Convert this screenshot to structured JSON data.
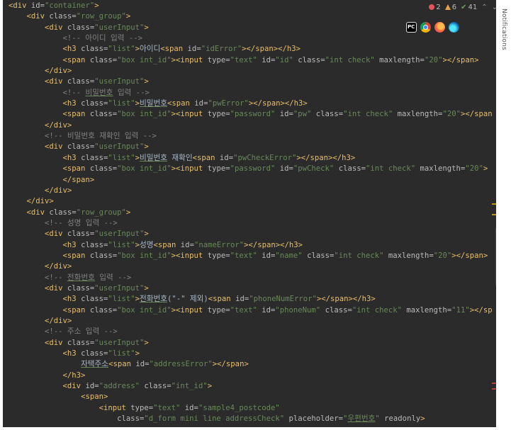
{
  "inspections": {
    "errors": "2",
    "warnings": "6",
    "weak_warnings": "41",
    "up_arrow": "⌃",
    "down_arrow": "⌄"
  },
  "side_panel": {
    "notifications_label": "Notifications"
  },
  "browser_icons": [
    "pycharm-icon",
    "chrome-icon",
    "firefox-icon",
    "edge-icon"
  ],
  "browser_labels": {
    "pycharm": "PC"
  },
  "colors": {
    "editor_bg": "#2b2b2b",
    "tag": "#e8bf6a",
    "attr": "#bababa",
    "value": "#6a8759",
    "comment": "#808080",
    "text": "#a9b7c6"
  },
  "code": {
    "lines": [
      [
        [
          "tag",
          "<div "
        ],
        [
          "attr",
          "id"
        ],
        [
          "eq",
          "="
        ],
        [
          "val",
          "\"container\""
        ],
        [
          "tag",
          ">"
        ]
      ],
      [
        [
          "ws",
          "    "
        ],
        [
          "tag",
          "<div "
        ],
        [
          "attr",
          "class"
        ],
        [
          "eq",
          "="
        ],
        [
          "val",
          "\"row_group\""
        ],
        [
          "tag",
          ">"
        ]
      ],
      [
        [
          "ws",
          "        "
        ],
        [
          "tag",
          "<div "
        ],
        [
          "attr",
          "class"
        ],
        [
          "eq",
          "="
        ],
        [
          "val",
          "\"userInput\""
        ],
        [
          "tag",
          ">"
        ]
      ],
      [
        [
          "ws",
          "            "
        ],
        [
          "cm",
          "<!-- 아이디 입력 -->"
        ]
      ],
      [
        [
          "ws",
          "            "
        ],
        [
          "tag",
          "<h3 "
        ],
        [
          "attr",
          "class"
        ],
        [
          "eq",
          "="
        ],
        [
          "val",
          "\"list\""
        ],
        [
          "tag",
          ">"
        ],
        [
          "txt",
          "아이디"
        ],
        [
          "tag",
          "<span "
        ],
        [
          "attr",
          "id"
        ],
        [
          "eq",
          "="
        ],
        [
          "val",
          "\"idError\""
        ],
        [
          "tag",
          "></span></h3>"
        ]
      ],
      [
        [
          "ws",
          "            "
        ],
        [
          "tag",
          "<span "
        ],
        [
          "attr",
          "class"
        ],
        [
          "eq",
          "="
        ],
        [
          "val",
          "\"box int_id\""
        ],
        [
          "tag",
          "><input "
        ],
        [
          "attr",
          "type"
        ],
        [
          "eq",
          "="
        ],
        [
          "val",
          "\"text\""
        ],
        [
          "attr",
          " id"
        ],
        [
          "eq",
          "="
        ],
        [
          "val",
          "\"id\""
        ],
        [
          "attr",
          " class"
        ],
        [
          "eq",
          "="
        ],
        [
          "val",
          "\"int check\""
        ],
        [
          "attr",
          " maxlength"
        ],
        [
          "eq",
          "="
        ],
        [
          "val",
          "\"20\""
        ],
        [
          "tag",
          "></span>"
        ]
      ],
      [
        [
          "ws",
          "        "
        ],
        [
          "tag",
          "</div>"
        ]
      ],
      [
        [
          "ws",
          "        "
        ],
        [
          "tag",
          "<div "
        ],
        [
          "attr",
          "class"
        ],
        [
          "eq",
          "="
        ],
        [
          "val",
          "\"userInput\""
        ],
        [
          "tag",
          ">"
        ]
      ],
      [
        [
          "ws",
          "            "
        ],
        [
          "cm",
          "<!-- "
        ],
        [
          "cmu",
          "비밀번호"
        ],
        [
          "cm",
          " 입력 -->"
        ]
      ],
      [
        [
          "ws",
          "            "
        ],
        [
          "tag",
          "<h3 "
        ],
        [
          "attr",
          "class"
        ],
        [
          "eq",
          "="
        ],
        [
          "val",
          "\"list\""
        ],
        [
          "tag",
          ">"
        ],
        [
          "txtu",
          "비밀번호"
        ],
        [
          "tag",
          "<span "
        ],
        [
          "attr",
          "id"
        ],
        [
          "eq",
          "="
        ],
        [
          "val",
          "\"pwError\""
        ],
        [
          "tag",
          "></span></h3>"
        ]
      ],
      [
        [
          "ws",
          "            "
        ],
        [
          "tag",
          "<span "
        ],
        [
          "attr",
          "class"
        ],
        [
          "eq",
          "="
        ],
        [
          "val",
          "\"box int_id\""
        ],
        [
          "tag",
          "><input "
        ],
        [
          "attr",
          "type"
        ],
        [
          "eq",
          "="
        ],
        [
          "val",
          "\"password\""
        ],
        [
          "attr",
          " id"
        ],
        [
          "eq",
          "="
        ],
        [
          "val",
          "\"pw\""
        ],
        [
          "attr",
          " class"
        ],
        [
          "eq",
          "="
        ],
        [
          "val",
          "\"int check\""
        ],
        [
          "attr",
          " maxlength"
        ],
        [
          "eq",
          "="
        ],
        [
          "val",
          "\"20\""
        ],
        [
          "tag",
          "></span"
        ]
      ],
      [
        [
          "ws",
          "        "
        ],
        [
          "tag",
          "</div>"
        ]
      ],
      [
        [
          "ws",
          "        "
        ],
        [
          "cm",
          "<!-- 비밀번호 재확인 입력 -->"
        ]
      ],
      [
        [
          "ws",
          "        "
        ],
        [
          "tag",
          "<div "
        ],
        [
          "attr",
          "class"
        ],
        [
          "eq",
          "="
        ],
        [
          "val",
          "\"userInput\""
        ],
        [
          "tag",
          ">"
        ]
      ],
      [
        [
          "ws",
          "            "
        ],
        [
          "tag",
          "<h3 "
        ],
        [
          "attr",
          "class"
        ],
        [
          "eq",
          "="
        ],
        [
          "val",
          "\"list\""
        ],
        [
          "tag",
          ">"
        ],
        [
          "txtu",
          "비밀번호"
        ],
        [
          "txt",
          " 재확인"
        ],
        [
          "tag",
          "<span "
        ],
        [
          "attr",
          "id"
        ],
        [
          "eq",
          "="
        ],
        [
          "val",
          "\"pwCheckError\""
        ],
        [
          "tag",
          "></span></h3>"
        ]
      ],
      [
        [
          "ws",
          "            "
        ],
        [
          "tag",
          "<span "
        ],
        [
          "attr",
          "class"
        ],
        [
          "eq",
          "="
        ],
        [
          "val",
          "\"box int_id\""
        ],
        [
          "tag",
          "><input "
        ],
        [
          "attr",
          "type"
        ],
        [
          "eq",
          "="
        ],
        [
          "val",
          "\"password\""
        ],
        [
          "attr",
          " id"
        ],
        [
          "eq",
          "="
        ],
        [
          "val",
          "\"pwCheck\""
        ],
        [
          "attr",
          " class"
        ],
        [
          "eq",
          "="
        ],
        [
          "val",
          "\"int check\""
        ],
        [
          "attr",
          " maxlength"
        ],
        [
          "eq",
          "="
        ],
        [
          "val",
          "\"20\""
        ],
        [
          "tag",
          "> "
        ]
      ],
      [
        [
          "ws",
          "            "
        ],
        [
          "tag",
          "</span>"
        ]
      ],
      [
        [
          "ws",
          "        "
        ],
        [
          "tag",
          "</div>"
        ]
      ],
      [
        [
          "ws",
          "    "
        ],
        [
          "tag",
          "</div>"
        ]
      ],
      [
        [
          "ws",
          "    "
        ],
        [
          "tag",
          "<div "
        ],
        [
          "attr",
          "class"
        ],
        [
          "eq",
          "="
        ],
        [
          "val",
          "\"row_group\""
        ],
        [
          "tag",
          ">"
        ]
      ],
      [
        [
          "ws",
          "        "
        ],
        [
          "cm",
          "<!-- 성명 입력 -->"
        ]
      ],
      [
        [
          "ws",
          "        "
        ],
        [
          "tag",
          "<div "
        ],
        [
          "attr",
          "class"
        ],
        [
          "eq",
          "="
        ],
        [
          "val",
          "\"userInput\""
        ],
        [
          "tag",
          ">"
        ]
      ],
      [
        [
          "ws",
          "            "
        ],
        [
          "tag",
          "<h3 "
        ],
        [
          "attr",
          "class"
        ],
        [
          "eq",
          "="
        ],
        [
          "val",
          "\"list\""
        ],
        [
          "tag",
          ">"
        ],
        [
          "txt",
          "성명"
        ],
        [
          "tag",
          "<span "
        ],
        [
          "attr",
          "id"
        ],
        [
          "eq",
          "="
        ],
        [
          "val",
          "\"nameError\""
        ],
        [
          "tag",
          "></span></h3>"
        ]
      ],
      [
        [
          "ws",
          "            "
        ],
        [
          "tag",
          "<span "
        ],
        [
          "attr",
          "class"
        ],
        [
          "eq",
          "="
        ],
        [
          "val",
          "\"box int_id\""
        ],
        [
          "tag",
          "><input "
        ],
        [
          "attr",
          "type"
        ],
        [
          "eq",
          "="
        ],
        [
          "val",
          "\"text\""
        ],
        [
          "attr",
          " id"
        ],
        [
          "eq",
          "="
        ],
        [
          "val",
          "\"name\""
        ],
        [
          "attr",
          " class"
        ],
        [
          "eq",
          "="
        ],
        [
          "val",
          "\"int check\""
        ],
        [
          "attr",
          " maxlength"
        ],
        [
          "eq",
          "="
        ],
        [
          "val",
          "\"20\""
        ],
        [
          "tag",
          "></span>"
        ]
      ],
      [
        [
          "ws",
          "        "
        ],
        [
          "tag",
          "</div>"
        ]
      ],
      [
        [
          "ws",
          "        "
        ],
        [
          "cm",
          "<!-- "
        ],
        [
          "cmu",
          "전화번호"
        ],
        [
          "cm",
          " 입력 -->"
        ]
      ],
      [
        [
          "ws",
          "        "
        ],
        [
          "tag",
          "<div "
        ],
        [
          "attr",
          "class"
        ],
        [
          "eq",
          "="
        ],
        [
          "val",
          "\"userInput\""
        ],
        [
          "tag",
          ">"
        ]
      ],
      [
        [
          "ws",
          "            "
        ],
        [
          "tag",
          "<h3 "
        ],
        [
          "attr",
          "class"
        ],
        [
          "eq",
          "="
        ],
        [
          "val",
          "\"list\""
        ],
        [
          "tag",
          ">"
        ],
        [
          "txtu",
          "전화번호"
        ],
        [
          "txt",
          "(\"-\" 제외)"
        ],
        [
          "tag",
          "<span "
        ],
        [
          "attr",
          "id"
        ],
        [
          "eq",
          "="
        ],
        [
          "val",
          "\"phoneNumError\""
        ],
        [
          "tag",
          "></span></h3>"
        ]
      ],
      [
        [
          "ws",
          "            "
        ],
        [
          "tag",
          "<span "
        ],
        [
          "attr",
          "class"
        ],
        [
          "eq",
          "="
        ],
        [
          "val",
          "\"box int_id\""
        ],
        [
          "tag",
          "><input "
        ],
        [
          "attr",
          "type"
        ],
        [
          "eq",
          "="
        ],
        [
          "val",
          "\"text\""
        ],
        [
          "attr",
          " id"
        ],
        [
          "eq",
          "="
        ],
        [
          "val",
          "\"phoneNum\""
        ],
        [
          "attr",
          " class"
        ],
        [
          "eq",
          "="
        ],
        [
          "val",
          "\"int check\""
        ],
        [
          "attr",
          " maxlength"
        ],
        [
          "eq",
          "="
        ],
        [
          "val",
          "\"11\""
        ],
        [
          "tag",
          "></sp"
        ]
      ],
      [
        [
          "ws",
          "        "
        ],
        [
          "tag",
          "</div>"
        ]
      ],
      [
        [
          "ws",
          "        "
        ],
        [
          "cm",
          "<!-- 주소 입력 -->"
        ]
      ],
      [
        [
          "ws",
          "        "
        ],
        [
          "tag",
          "<div "
        ],
        [
          "attr",
          "class"
        ],
        [
          "eq",
          "="
        ],
        [
          "val",
          "\"userInput\""
        ],
        [
          "tag",
          ">"
        ]
      ],
      [
        [
          "ws",
          "            "
        ],
        [
          "tag",
          "<h3 "
        ],
        [
          "attr",
          "class"
        ],
        [
          "eq",
          "="
        ],
        [
          "val",
          "\"list\""
        ],
        [
          "tag",
          ">"
        ]
      ],
      [
        [
          "ws",
          "                "
        ],
        [
          "txtu",
          "자택주소"
        ],
        [
          "tag",
          "<span "
        ],
        [
          "attr",
          "id"
        ],
        [
          "eq",
          "="
        ],
        [
          "val",
          "\"addressError\""
        ],
        [
          "tag",
          "></span>"
        ]
      ],
      [
        [
          "ws",
          "            "
        ],
        [
          "tag",
          "</h3>"
        ]
      ],
      [
        [
          "ws",
          "            "
        ],
        [
          "tag",
          "<div "
        ],
        [
          "attr",
          "id"
        ],
        [
          "eq",
          "="
        ],
        [
          "val",
          "\"address\""
        ],
        [
          "attr",
          " class"
        ],
        [
          "eq",
          "="
        ],
        [
          "val",
          "\"int_id\""
        ],
        [
          "tag",
          ">"
        ]
      ],
      [
        [
          "ws",
          "                "
        ],
        [
          "tag",
          "<span>"
        ]
      ],
      [
        [
          "ws",
          "                    "
        ],
        [
          "tag",
          "<input "
        ],
        [
          "attr",
          "type"
        ],
        [
          "eq",
          "="
        ],
        [
          "val",
          "\"text\""
        ],
        [
          "attr",
          " id"
        ],
        [
          "eq",
          "="
        ],
        [
          "val",
          "\"sample4_postcode\""
        ]
      ],
      [
        [
          "ws",
          "                        "
        ],
        [
          "attr",
          "class"
        ],
        [
          "eq",
          "="
        ],
        [
          "val",
          "\"d_form mini line addressCheck\""
        ],
        [
          "attr",
          " placeholder"
        ],
        [
          "eq",
          "="
        ],
        [
          "val",
          "\""
        ],
        [
          "valu",
          "우편번호"
        ],
        [
          "val",
          "\""
        ],
        [
          "attr",
          " readonly"
        ],
        [
          "tag",
          ">"
        ]
      ]
    ]
  }
}
